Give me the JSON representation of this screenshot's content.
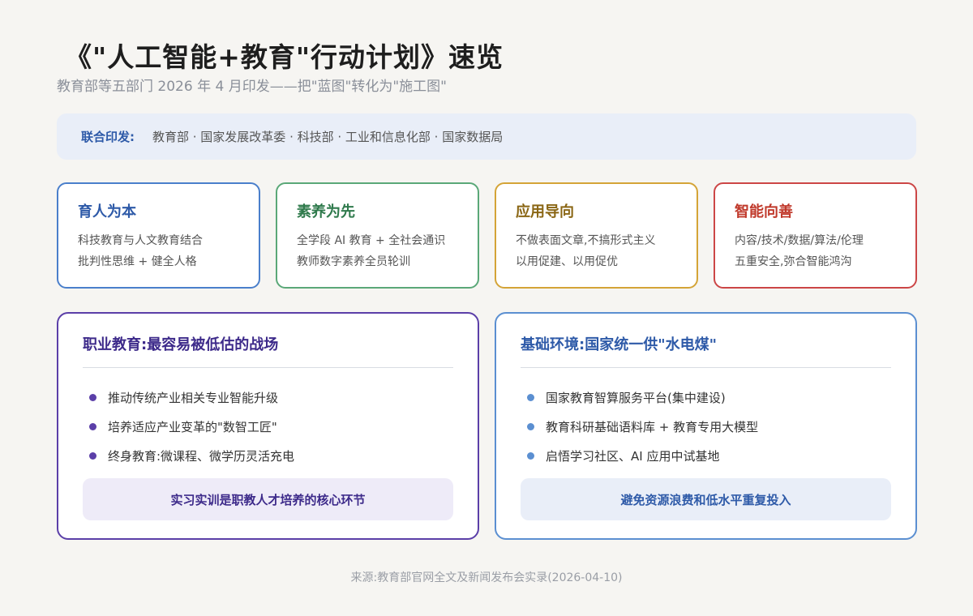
{
  "header": {
    "title": "《\"人工智能+教育\"行动计划》速览",
    "subtitle": "教育部等五部门 2026 年 4 月印发——把\"蓝图\"转化为\"施工图\""
  },
  "joint_issue": {
    "label": "联合印发:",
    "departments": "教育部 · 国家发展改革委 · 科技部 · 工业和信息化部 · 国家数据局"
  },
  "principles": [
    {
      "title": "育人为本",
      "lines": [
        "科技教育与人文教育结合",
        "批判性思维 + 健全人格"
      ],
      "color": "#4a7fcb",
      "title_color": "#2e5aa8"
    },
    {
      "title": "素养为先",
      "lines": [
        "全学段 AI 教育 + 全社会通识",
        "教师数字素养全员轮训"
      ],
      "color": "#5aa878",
      "title_color": "#2f7a4c"
    },
    {
      "title": "应用导向",
      "lines": [
        "不做表面文章,不搞形式主义",
        "以用促建、以用促优"
      ],
      "color": "#d4a437",
      "title_color": "#8a6614"
    },
    {
      "title": "智能向善",
      "lines": [
        "内容/技术/数据/算法/伦理",
        "五重安全,弥合智能鸿沟"
      ],
      "color": "#cc4646",
      "title_color": "#c0392b"
    }
  ],
  "vocational": {
    "title": "职业教育:最容易被低估的战场",
    "items": [
      "推动传统产业相关专业智能升级",
      "培养适应产业变革的\"数智工匠\"",
      "终身教育:微课程、微学历灵活充电"
    ],
    "note": "实习实训是职教人才培养的核心环节",
    "color": "#5b3fa8",
    "title_color": "#3d2a8a",
    "note_bg": "#eeebf8"
  },
  "infrastructure": {
    "title": "基础环境:国家统一供\"水电煤\"",
    "items": [
      "国家教育智算服务平台(集中建设)",
      "教育科研基础语料库 + 教育专用大模型",
      "启悟学习社区、AI 应用中试基地"
    ],
    "note": "避免资源浪费和低水平重复投入",
    "color": "#5b8fd1",
    "title_color": "#2e5aa8",
    "note_bg": "#e9eef8"
  },
  "footer": {
    "source": "来源:教育部官网全文及新闻发布会实录(2026-04-10)"
  }
}
